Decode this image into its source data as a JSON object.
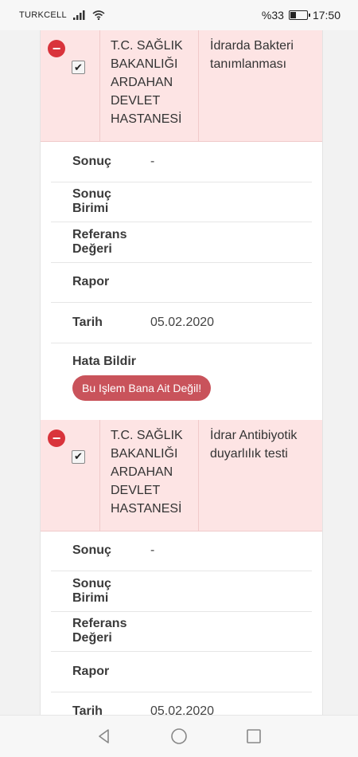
{
  "status": {
    "carrier": "TURKCELL",
    "battery": "%33",
    "battery_level": 0.33,
    "time": "17:50"
  },
  "records": [
    {
      "hospital": [
        "T.C. SAĞLIK",
        "BAKANLIĞI",
        "ARDAHAN",
        "DEVLET",
        "HASTANESİ"
      ],
      "test": [
        "İdrarda Bakteri",
        "tanımlanması"
      ],
      "details": [
        {
          "label": "Sonuç",
          "value": "-"
        },
        {
          "label": "Sonuç Birimi",
          "value": ""
        },
        {
          "label": "Referans Değeri",
          "value": ""
        },
        {
          "label": "Rapor",
          "value": ""
        },
        {
          "label": "Tarih",
          "value": "05.02.2020"
        }
      ],
      "hata_label": "Hata Bildir",
      "hata_button": "Bu Işlem Bana Ait Değil!"
    },
    {
      "hospital": [
        "T.C. SAĞLIK",
        "BAKANLIĞI",
        "ARDAHAN",
        "DEVLET",
        "HASTANESİ"
      ],
      "test": [
        "İdrar Antibiyotik",
        "duyarlılık testi"
      ],
      "details": [
        {
          "label": "Sonuç",
          "value": "-"
        },
        {
          "label": "Sonuç Birimi",
          "value": ""
        },
        {
          "label": "Referans Değeri",
          "value": ""
        },
        {
          "label": "Rapor",
          "value": ""
        },
        {
          "label": "Tarih",
          "value": "05.02.2020"
        }
      ]
    }
  ],
  "icons": {
    "signal": "signal-icon",
    "wifi": "wifi-icon",
    "back": "back-icon",
    "home": "home-icon",
    "recents": "recents-icon"
  }
}
